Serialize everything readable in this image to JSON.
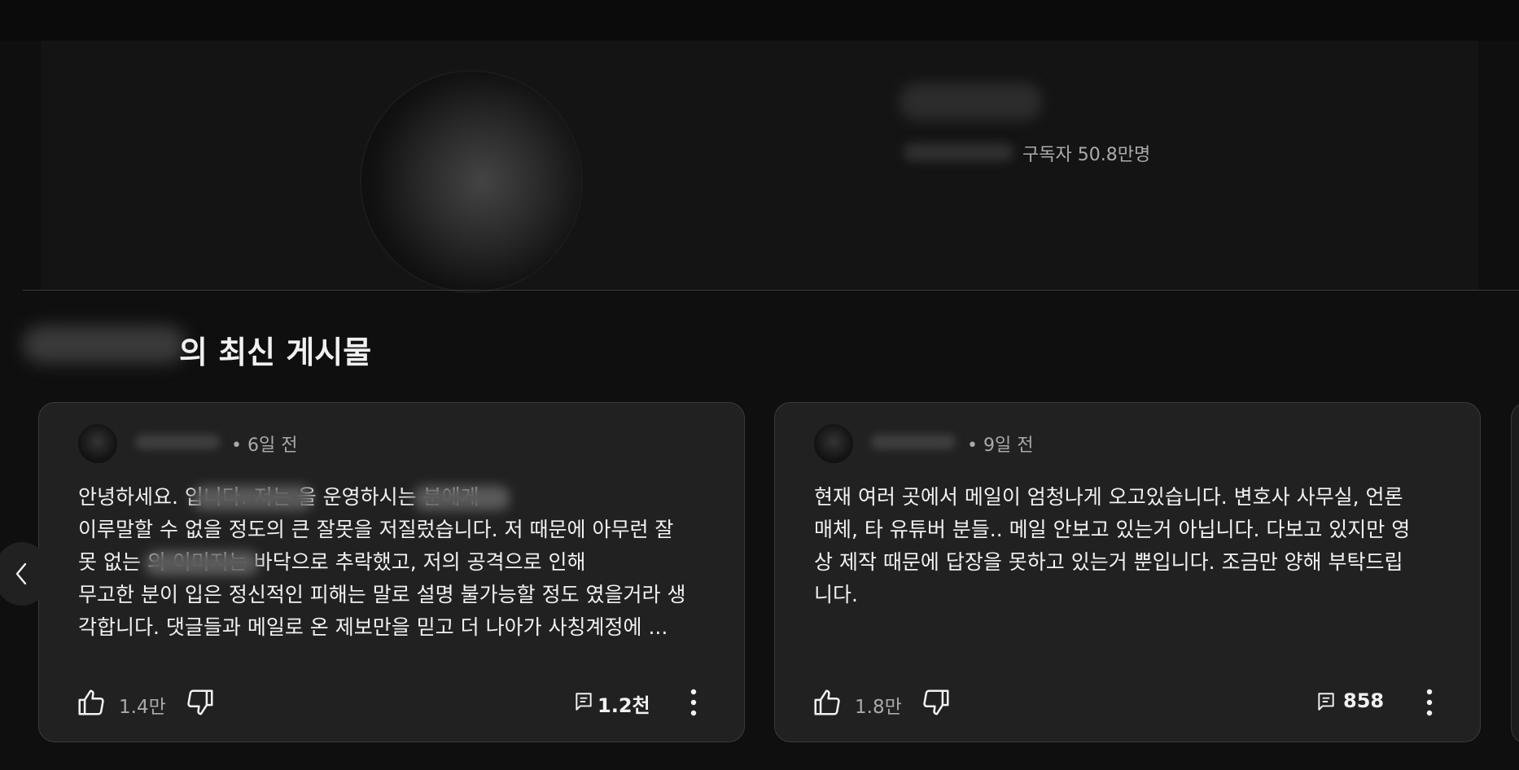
{
  "channel": {
    "subscribers": "구독자 50.8만명"
  },
  "section": {
    "title": "의 최신 게시물"
  },
  "posts": [
    {
      "time": "• 6일 전",
      "body": "안녕하세요.             입니다. 저는             을 운영하시는 분에게\n이루말할 수 없을 정도의 큰 잘못을 저질렀습니다. 저 때문에 아무런 잘\n못 없는             의 이미지는 바닥으로 추락했고, 저의 공격으로 인해\n무고한 분이 입은 정신적인 피해는 말로 설명 불가능할 정도 였을거라 생\n각합니다.  댓글들과 메일로 온 제보만을 믿고 더 나아가 사칭계정에 ...",
      "likes": "1.4만",
      "comments": "1.2천"
    },
    {
      "time": "• 9일 전",
      "body": "현재 여러 곳에서 메일이 엄청나게 오고있습니다. 변호사 사무실, 언론\n매체, 타 유튜버 분들.. 메일 안보고 있는거 아닙니다. 다보고 있지만 영\n상 제작 때문에 답장을 못하고 있는거 뿐입니다. 조금만 양해 부탁드립\n니다.",
      "likes": "1.8만",
      "comments": "858"
    }
  ],
  "icons": {
    "like": "thumb-up-icon",
    "dislike": "thumb-down-icon",
    "comment": "comment-icon",
    "more": "more-vert-icon",
    "prev": "chevron-left-icon"
  },
  "colors": {
    "background": "#0f0f0f",
    "card": "#212121",
    "text": "#f1f1f1",
    "secondary_text": "#aaaaaa"
  }
}
